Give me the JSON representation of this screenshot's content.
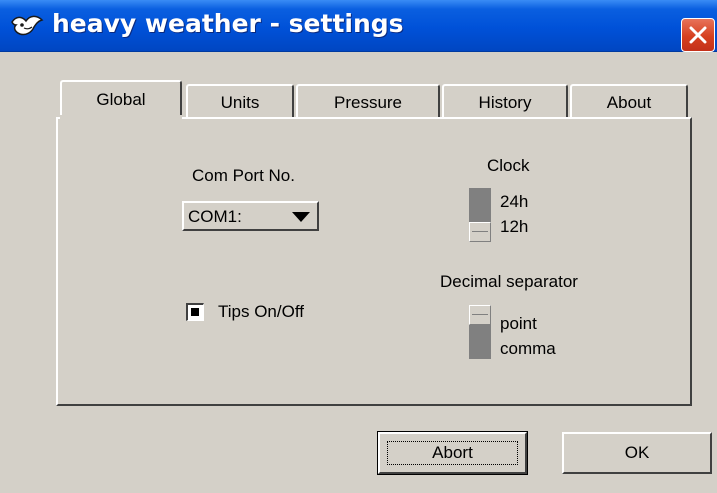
{
  "window": {
    "title": "heavy weather - settings",
    "app_icon": "bird-icon",
    "close_icon": "close-icon",
    "colors": {
      "titlebar": "#0a5fe0",
      "close": "#d6401f",
      "face": "#d4d0c8"
    }
  },
  "tabs": [
    {
      "label": "Global",
      "active": true
    },
    {
      "label": "Units",
      "active": false
    },
    {
      "label": "Pressure",
      "active": false
    },
    {
      "label": "History",
      "active": false
    },
    {
      "label": "About",
      "active": false
    }
  ],
  "global": {
    "com_port_label": "Com Port No.",
    "com_port_value": "COM1:",
    "tips_label": "Tips On/Off",
    "tips_checked": true,
    "clock_label": "Clock",
    "clock_options": [
      "24h",
      "12h"
    ],
    "clock_selected": "12h",
    "decimal_label": "Decimal separator",
    "decimal_options": [
      "point",
      "comma"
    ],
    "decimal_selected": "point"
  },
  "buttons": {
    "abort": "Abort",
    "ok": "OK"
  }
}
